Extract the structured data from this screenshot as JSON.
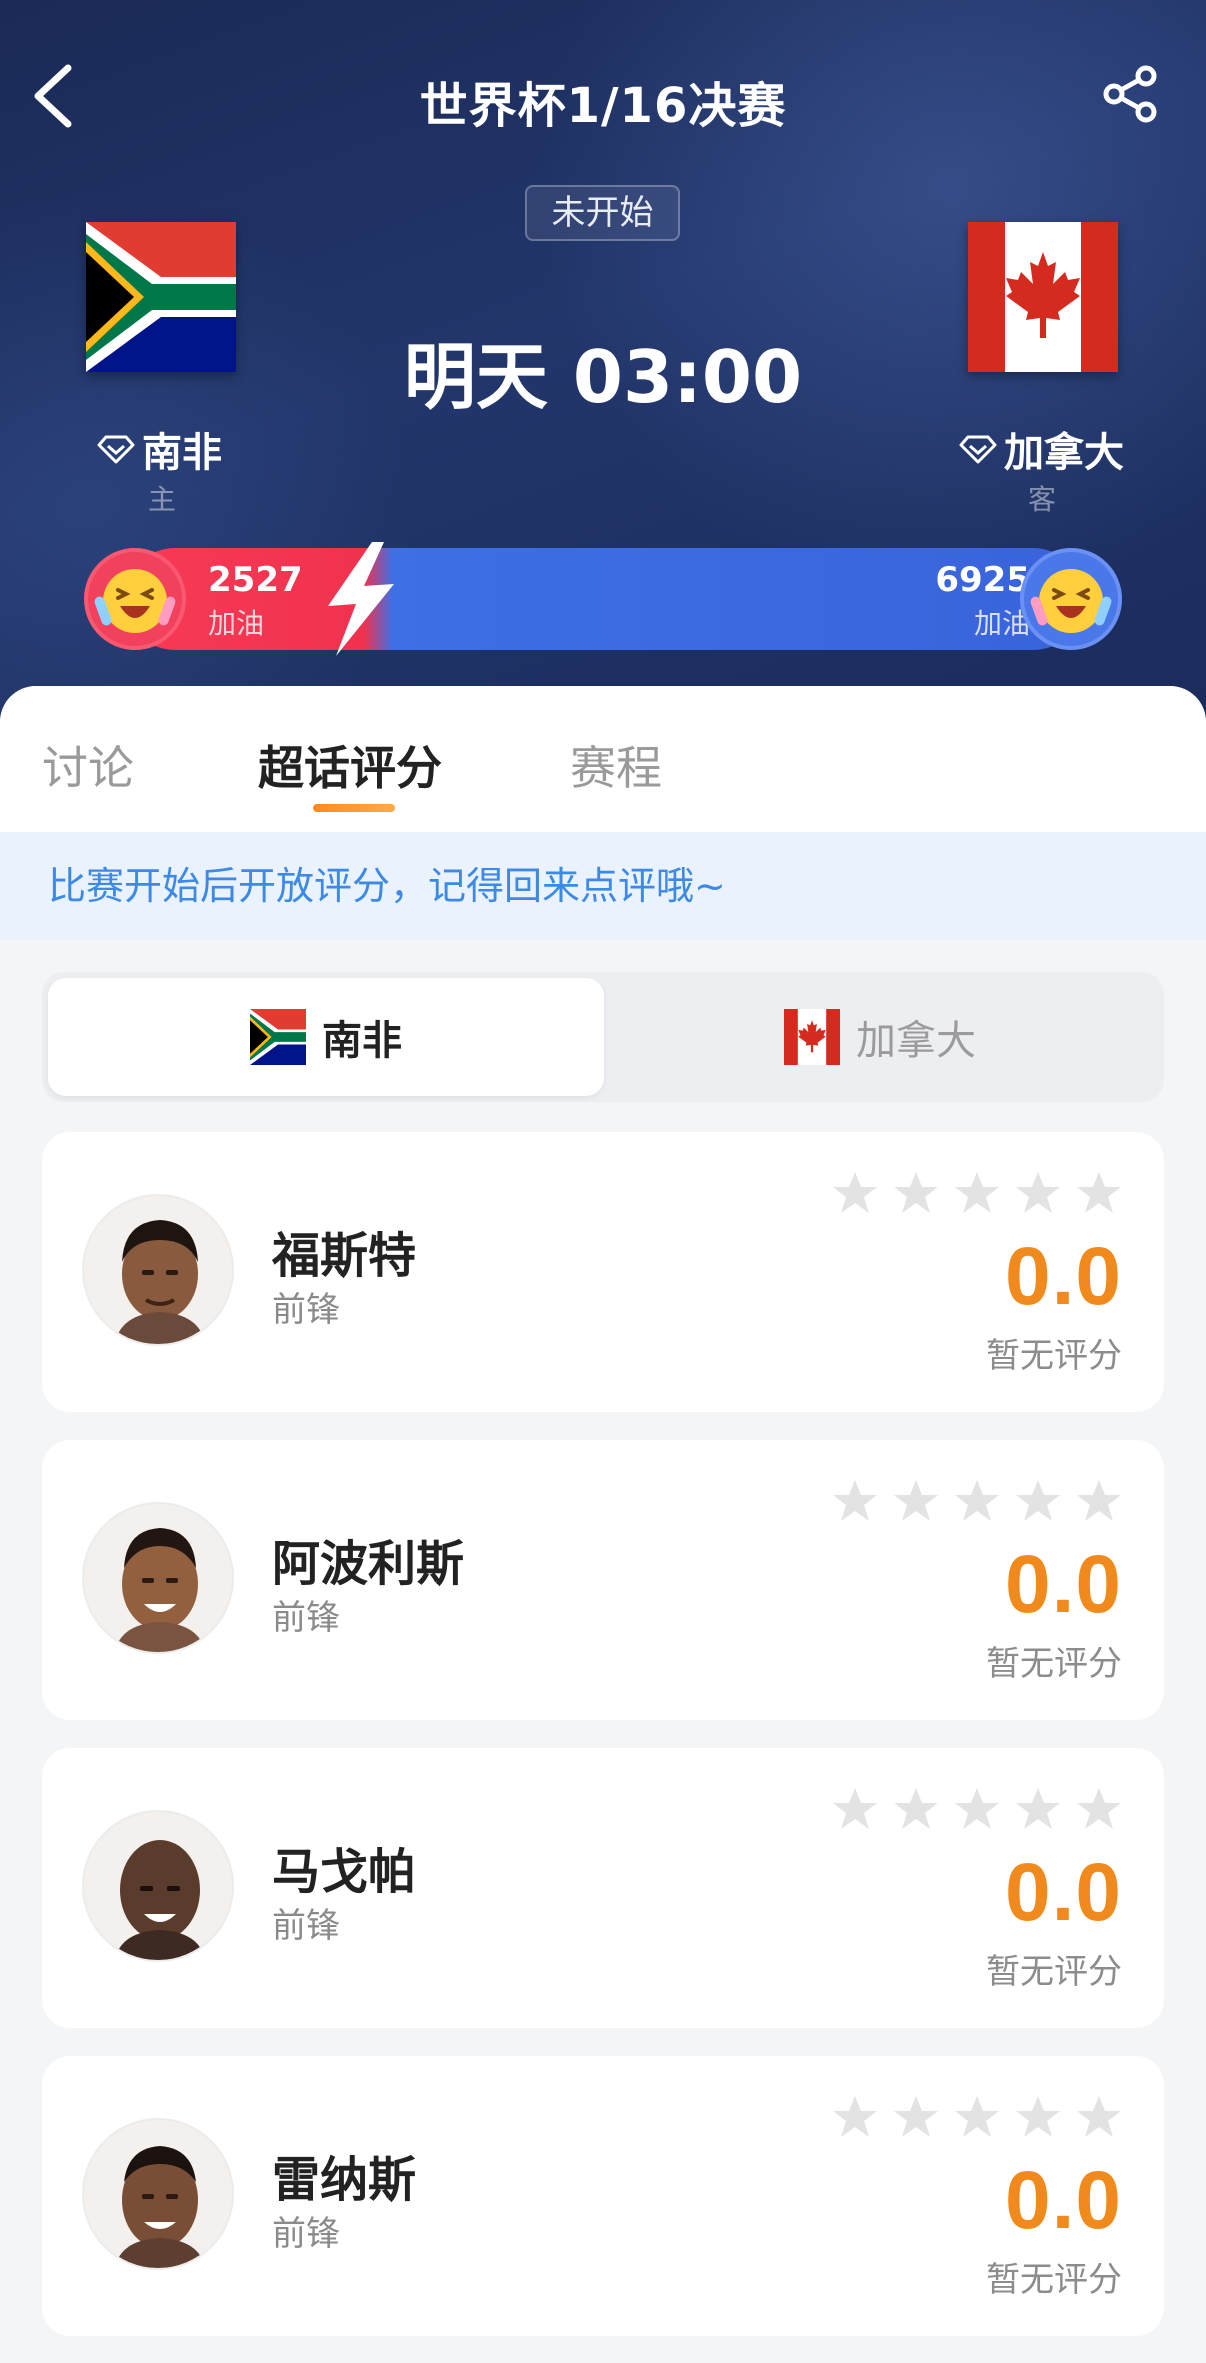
{
  "header": {
    "title": "世界杯1/16决赛",
    "status": "未开始",
    "time": "明天 03:00"
  },
  "home": {
    "name": "南非",
    "role": "主",
    "cheer_count": "2527",
    "cheer_label": "加油"
  },
  "away": {
    "name": "加拿大",
    "role": "客",
    "cheer_count": "6925",
    "cheer_label": "加油"
  },
  "cheer_share_home": 0.27,
  "tabs": [
    {
      "label": "讨论"
    },
    {
      "label": "超话评分"
    },
    {
      "label": "赛程"
    }
  ],
  "notice": "比赛开始后开放评分，记得回来点评哦~",
  "team_switch": {
    "home_label": "南非",
    "away_label": "加拿大",
    "selected": "南非"
  },
  "players": [
    {
      "name": "福斯特",
      "position": "前锋",
      "score": "0.0",
      "note": "暂无评分",
      "stars": 0
    },
    {
      "name": "阿波利斯",
      "position": "前锋",
      "score": "0.0",
      "note": "暂无评分",
      "stars": 0
    },
    {
      "name": "马戈帕",
      "position": "前锋",
      "score": "0.0",
      "note": "暂无评分",
      "stars": 0
    },
    {
      "name": "雷纳斯",
      "position": "前锋",
      "score": "0.0",
      "note": "暂无评分",
      "stars": 0
    }
  ],
  "colors": {
    "header_bg": "#1f3163",
    "home_cheer": "#f0324f",
    "away_cheer": "#3a63da",
    "accent_orange": "#f08a1c",
    "notice_text": "#3c8ae6"
  },
  "icons": {
    "back": "chevron-left-icon",
    "share": "share-icon",
    "badge": "diamond-icon",
    "cheer": "laughing-face-icon",
    "bolt": "lightning-icon",
    "star": "star-icon"
  }
}
